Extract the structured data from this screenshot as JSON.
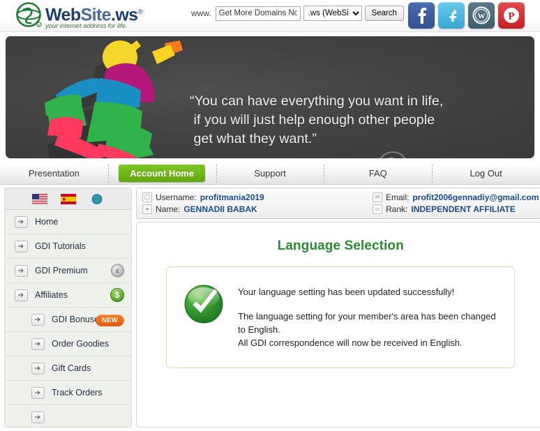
{
  "header": {
    "logo": {
      "icon": "globe-logo-icon",
      "name_web": "Web",
      "name_site": "Site",
      "name_ws": ".ws",
      "registered_mark": "®",
      "tagline": "your internet address for life."
    },
    "search": {
      "www_label": "www.",
      "domain_value": "Get More Domains Now",
      "domain_placeholder": "Get More Domains Now",
      "tld_selected": ".ws (WebSite)",
      "tld_options": [
        ".ws (WebSite)"
      ],
      "button_label": "Search"
    },
    "social": [
      {
        "name": "facebook-icon",
        "glyph": "f",
        "color": "#3b5998"
      },
      {
        "name": "twitter-icon",
        "glyph": "t",
        "color": "#4eb5e0"
      },
      {
        "name": "wordpress-icon",
        "glyph": "W",
        "color": "#46657a"
      },
      {
        "name": "pinterest-icon",
        "glyph": "P",
        "color": "#cb2027"
      }
    ]
  },
  "banner": {
    "quote": "“You can have everything you want in life,\n if you will just help enough other people\n get what they want.”",
    "watermark": "gdi-globe-watermark"
  },
  "tabs": [
    {
      "label": "Presentation",
      "active": false
    },
    {
      "label": "Account Home",
      "active": true
    },
    {
      "label": "Support",
      "active": false
    },
    {
      "label": "FAQ",
      "active": false
    },
    {
      "label": "Log Out",
      "active": false
    }
  ],
  "sidebar": {
    "flags": [
      {
        "name": "flag-usa",
        "title": "English"
      },
      {
        "name": "flag-spain",
        "title": "Español"
      },
      {
        "name": "flag-globe",
        "title": "Other"
      }
    ],
    "items": [
      {
        "label": "Home",
        "sub": false,
        "badge": null,
        "accessory": null
      },
      {
        "label": "GDI Tutorials",
        "sub": false,
        "badge": null,
        "accessory": null
      },
      {
        "label": "GDI Premium",
        "sub": false,
        "badge": null,
        "accessory": "coin-gray"
      },
      {
        "label": "Affiliates",
        "sub": false,
        "badge": null,
        "accessory": "coin-green"
      },
      {
        "label": "GDI Bonuses",
        "sub": true,
        "badge": "NEW",
        "accessory": null
      },
      {
        "label": "Order Goodies",
        "sub": true,
        "badge": null,
        "accessory": null
      },
      {
        "label": "Gift Cards",
        "sub": true,
        "badge": null,
        "accessory": null
      },
      {
        "label": "Track Orders",
        "sub": true,
        "badge": null,
        "accessory": null
      }
    ]
  },
  "account_bar": {
    "username_label": "Username:",
    "username_value": "profitmania2019",
    "name_label": "Name:",
    "name_value": "GENNADII BABAK",
    "email_label": "Email:",
    "email_value": "profit2006gennadiy@gmail.com",
    "rank_label": "Rank:",
    "rank_value": "INDEPENDENT AFFILIATE"
  },
  "main": {
    "title": "Language Selection",
    "message_headline": "Your language setting has been updated successfully!",
    "message_line1": "The language setting for your member's area has been changed to English.",
    "message_line2": "All GDI correspondence will now be received in English.",
    "status_icon": "success-check-icon"
  },
  "colors": {
    "brand_green": "#2a8a2e",
    "tab_active_green": "#6fb418",
    "link_blue": "#1a4b8c",
    "badge_orange": "#e05a12",
    "banner_bg": "#434343"
  }
}
